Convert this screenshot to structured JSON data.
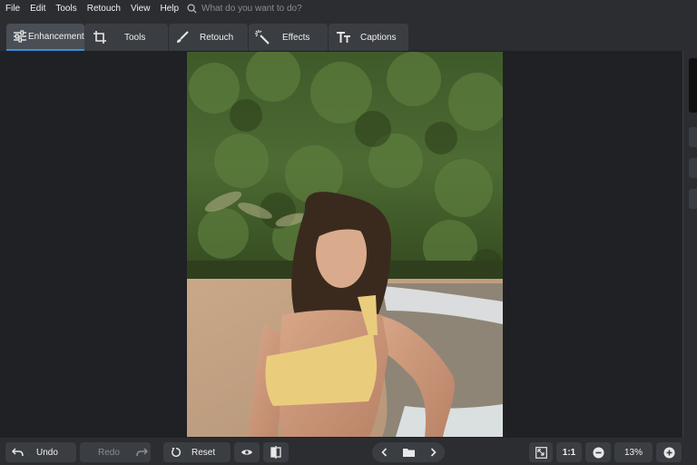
{
  "menu": {
    "items": [
      "File",
      "Edit",
      "Tools",
      "Retouch",
      "View",
      "Help"
    ],
    "search_placeholder": "What do you want to do?"
  },
  "tabs": [
    {
      "label": "Enhancement",
      "icon": "sliders-icon",
      "active": true
    },
    {
      "label": "Tools",
      "icon": "crop-icon"
    },
    {
      "label": "Retouch",
      "icon": "brush-icon"
    },
    {
      "label": "Effects",
      "icon": "magic-wand-icon"
    },
    {
      "label": "Captions",
      "icon": "text-icon"
    }
  ],
  "bottom": {
    "undo": "Undo",
    "redo": "Redo",
    "reset": "Reset",
    "actual_size": "1:1",
    "zoom": "13%"
  },
  "colors": {
    "accent": "#3b8fd9",
    "panel": "#2b2d31",
    "button": "#3a3d42",
    "canvas": "#1f2124"
  }
}
